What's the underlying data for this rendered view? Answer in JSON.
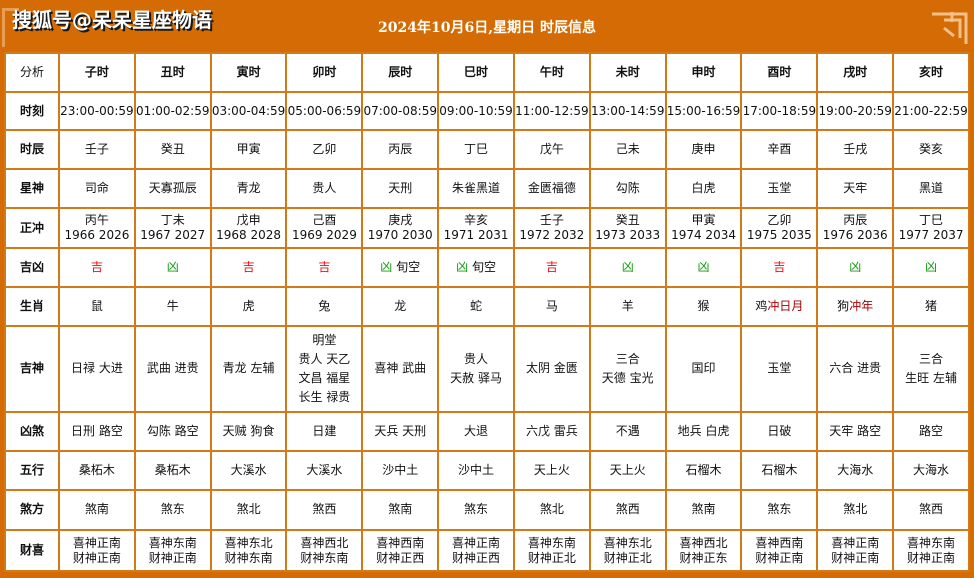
{
  "header": {
    "watermark": "搜狐号@呆呆星座物语",
    "title": "2024年10月6日,星期日 时辰信息"
  },
  "table": {
    "corner_label": "分析",
    "columns": [
      "子时",
      "丑时",
      "寅时",
      "卯时",
      "辰时",
      "巳时",
      "午时",
      "未时",
      "申时",
      "酉时",
      "戌时",
      "亥时"
    ],
    "row_labels": {
      "time": "时刻",
      "shichen": "时辰",
      "xingshen": "星神",
      "zhengchong": "正冲",
      "jixiong": "吉凶",
      "shengxiao": "生肖",
      "jishen": "吉神",
      "xiongsha": "凶煞",
      "wuxing": "五行",
      "shafang": "煞方",
      "caixi": "财喜"
    },
    "time": [
      "23:00-00:59",
      "01:00-02:59",
      "03:00-04:59",
      "05:00-06:59",
      "07:00-08:59",
      "09:00-10:59",
      "11:00-12:59",
      "13:00-14:59",
      "15:00-16:59",
      "17:00-18:59",
      "19:00-20:59",
      "21:00-22:59"
    ],
    "shichen": [
      "壬子",
      "癸丑",
      "甲寅",
      "乙卯",
      "丙辰",
      "丁巳",
      "戊午",
      "己未",
      "庚申",
      "辛酉",
      "壬戌",
      "癸亥"
    ],
    "xingshen": [
      "司命",
      "天寡孤辰",
      "青龙",
      "贵人",
      "天刑",
      "朱雀黑道",
      "金匮福德",
      "勾陈",
      "白虎",
      "玉堂",
      "天牢",
      "黑道"
    ],
    "zhengchong": [
      {
        "ganzhi": "丙午",
        "years": "1966 2026"
      },
      {
        "ganzhi": "丁未",
        "years": "1967 2027"
      },
      {
        "ganzhi": "戊申",
        "years": "1968 2028"
      },
      {
        "ganzhi": "己酉",
        "years": "1969 2029"
      },
      {
        "ganzhi": "庚戌",
        "years": "1970 2030"
      },
      {
        "ganzhi": "辛亥",
        "years": "1971 2031"
      },
      {
        "ganzhi": "壬子",
        "years": "1972 2032"
      },
      {
        "ganzhi": "癸丑",
        "years": "1973 2033"
      },
      {
        "ganzhi": "甲寅",
        "years": "1974 2034"
      },
      {
        "ganzhi": "乙卯",
        "years": "1975 2035"
      },
      {
        "ganzhi": "丙辰",
        "years": "1976 2036"
      },
      {
        "ganzhi": "丁巳",
        "years": "1977 2037"
      }
    ],
    "jixiong": [
      {
        "verdict": "吉",
        "type": "ji",
        "note": ""
      },
      {
        "verdict": "凶",
        "type": "xiong",
        "note": ""
      },
      {
        "verdict": "吉",
        "type": "ji",
        "note": ""
      },
      {
        "verdict": "吉",
        "type": "ji",
        "note": ""
      },
      {
        "verdict": "凶",
        "type": "xiong",
        "note": "旬空"
      },
      {
        "verdict": "凶",
        "type": "xiong",
        "note": "旬空"
      },
      {
        "verdict": "吉",
        "type": "ji",
        "note": ""
      },
      {
        "verdict": "凶",
        "type": "xiong",
        "note": ""
      },
      {
        "verdict": "凶",
        "type": "xiong",
        "note": ""
      },
      {
        "verdict": "吉",
        "type": "ji",
        "note": ""
      },
      {
        "verdict": "凶",
        "type": "xiong",
        "note": ""
      },
      {
        "verdict": "凶",
        "type": "xiong",
        "note": ""
      }
    ],
    "shengxiao": [
      {
        "animal": "鼠",
        "conflict": ""
      },
      {
        "animal": "牛",
        "conflict": ""
      },
      {
        "animal": "虎",
        "conflict": ""
      },
      {
        "animal": "兔",
        "conflict": ""
      },
      {
        "animal": "龙",
        "conflict": ""
      },
      {
        "animal": "蛇",
        "conflict": ""
      },
      {
        "animal": "马",
        "conflict": ""
      },
      {
        "animal": "羊",
        "conflict": ""
      },
      {
        "animal": "猴",
        "conflict": ""
      },
      {
        "animal": "鸡",
        "conflict": "冲日月"
      },
      {
        "animal": "狗",
        "conflict": "冲年"
      },
      {
        "animal": "猪",
        "conflict": ""
      }
    ],
    "jishen": [
      [
        "日禄 大进"
      ],
      [
        "武曲 进贵"
      ],
      [
        "青龙 左辅"
      ],
      [
        "明堂",
        "贵人 天乙",
        "文昌 福星",
        "长生 禄贵"
      ],
      [
        "喜神 武曲"
      ],
      [
        "贵人",
        "天赦 驿马"
      ],
      [
        "太阴 金匮"
      ],
      [
        "三合",
        "天德 宝光"
      ],
      [
        "国印"
      ],
      [
        "玉堂"
      ],
      [
        "六合 进贵"
      ],
      [
        "三合",
        "生旺 左辅"
      ]
    ],
    "xiongsha": [
      "日刑 路空",
      "勾陈 路空",
      "天贼 狗食",
      "日建",
      "天兵 天刑",
      "大退",
      "六戊 雷兵",
      "不遇",
      "地兵 白虎",
      "日破",
      "天牢 路空",
      "路空"
    ],
    "wuxing": [
      "桑柘木",
      "桑柘木",
      "大溪水",
      "大溪水",
      "沙中土",
      "沙中土",
      "天上火",
      "天上火",
      "石榴木",
      "石榴木",
      "大海水",
      "大海水"
    ],
    "shafang": [
      "煞南",
      "煞东",
      "煞北",
      "煞西",
      "煞南",
      "煞东",
      "煞北",
      "煞西",
      "煞南",
      "煞东",
      "煞北",
      "煞西"
    ],
    "caixi": [
      {
        "xi": "喜神正南",
        "cai": "财神正南"
      },
      {
        "xi": "喜神东南",
        "cai": "财神正南"
      },
      {
        "xi": "喜神东北",
        "cai": "财神东南"
      },
      {
        "xi": "喜神西北",
        "cai": "财神东南"
      },
      {
        "xi": "喜神西南",
        "cai": "财神正西"
      },
      {
        "xi": "喜神正南",
        "cai": "财神正西"
      },
      {
        "xi": "喜神东南",
        "cai": "财神正北"
      },
      {
        "xi": "喜神东北",
        "cai": "财神正北"
      },
      {
        "xi": "喜神西北",
        "cai": "财神正东"
      },
      {
        "xi": "喜神西南",
        "cai": "财神正南"
      },
      {
        "xi": "喜神正南",
        "cai": "财神正南"
      },
      {
        "xi": "喜神东南",
        "cai": "财神正南"
      }
    ]
  },
  "colors": {
    "frame": "#d46b04",
    "border": "#d07a1a",
    "ji": "#ee1111",
    "xiong": "#119911",
    "conflict": "#a30000",
    "row_label": "#1a1448"
  }
}
